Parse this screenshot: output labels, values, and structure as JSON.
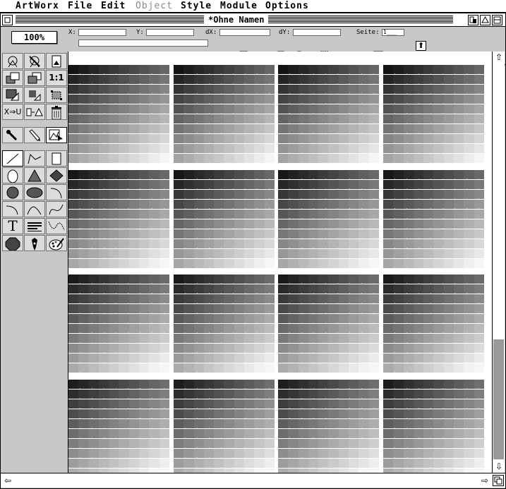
{
  "menubar": {
    "items": [
      {
        "label": "ArtWorx",
        "enabled": true
      },
      {
        "label": "File",
        "enabled": true
      },
      {
        "label": "Edit",
        "enabled": true
      },
      {
        "label": "Object",
        "enabled": false
      },
      {
        "label": "Style",
        "enabled": true
      },
      {
        "label": "Module",
        "enabled": true
      },
      {
        "label": "Options",
        "enabled": true
      }
    ]
  },
  "window": {
    "title": "*Ohne Namen",
    "buttons": [
      "close-icon",
      "iconify-icon",
      "full-icon",
      "scroll-up-icon"
    ]
  },
  "toolbar": {
    "zoom": "100%",
    "fields": {
      "x_label": "X:",
      "x_value": "",
      "y_label": "Y:",
      "y_value": "",
      "dx_label": "dX:",
      "dx_value": "",
      "dy_label": "dY:",
      "dy_value": "",
      "page_label": "Seite:",
      "page_value": "1___"
    },
    "icons": [
      "save-icon",
      "print-icon",
      "cut-icon",
      "copy-icon",
      "paste-icon",
      "crop-icon",
      "text-style-icon",
      "fill-icon",
      "gradient-icon",
      "align-icon"
    ],
    "page_up_icon": "page-up-arrow-icon",
    "page_down_icon": "page-down-arrow-icon"
  },
  "palette": {
    "one_to_one": "1:1",
    "x_to_u": "X⇒U",
    "text_tool": "T"
  },
  "canvas": {
    "grid_rows": 4,
    "grid_cols": 4,
    "strips_per_block": 10,
    "cells_per_strip": 10
  },
  "colors": {
    "background": "#c8c8c8",
    "canvas": "#ffffff",
    "dark_gray": "#141414",
    "light_gray": "#f4f4f4",
    "scroll_thumb": "#999999"
  }
}
